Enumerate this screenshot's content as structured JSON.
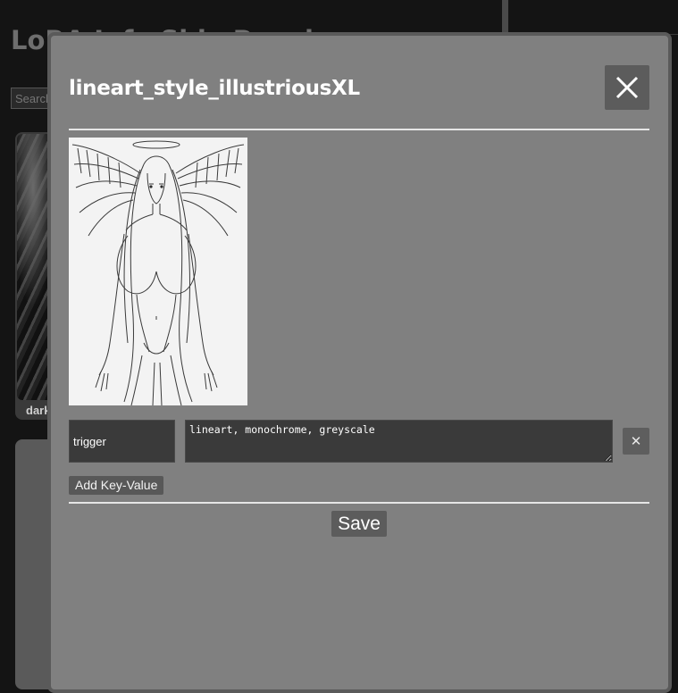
{
  "background": {
    "page_title": "LoRA Info Side Panel",
    "search_placeholder": "Search",
    "card_caption": "dark"
  },
  "modal": {
    "title": "lineart_style_illustriousXL",
    "close_icon": "close-icon",
    "preview_icon": "preview-image",
    "fields": [
      {
        "key": "trigger",
        "value": "lineart, monochrome, greyscale",
        "remove_label": "✕"
      }
    ],
    "add_kv_label": "Add Key-Value",
    "save_label": "Save"
  },
  "colors": {
    "modal_bg": "#808080",
    "button_bg": "#5c5c5c",
    "input_bg": "#3a3a3a",
    "page_bg": "#141414"
  }
}
